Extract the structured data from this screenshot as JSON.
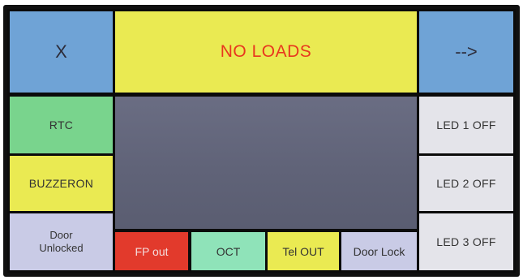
{
  "colors": {
    "blue": "#6fa3d6",
    "yellow": "#eaea52",
    "green": "#79d48d",
    "light": "#e4e4ea",
    "lavender": "#c9cbe6",
    "red": "#e23a2c",
    "mint": "#8fe3b9",
    "display": "#62657a",
    "title_text": "#e8371e"
  },
  "header": {
    "close_label": "X",
    "title": "NO LOADS",
    "next_label": "-->"
  },
  "left_panel": {
    "rtc_label": "RTC",
    "buzzer_label": "BUZZERON",
    "door_status_label": "Door\nUnlocked"
  },
  "right_panel": {
    "led1_label": "LED 1 OFF",
    "led2_label": "LED 2 OFF",
    "led3_label": "LED 3 OFF"
  },
  "bottom_bar": {
    "fp_out_label": "FP out",
    "oct_label": "OCT",
    "tel_out_label": "Tel OUT",
    "door_lock_label": "Door Lock"
  },
  "icons": {
    "close": "x-glyph",
    "next": "arrow-right-glyph"
  }
}
